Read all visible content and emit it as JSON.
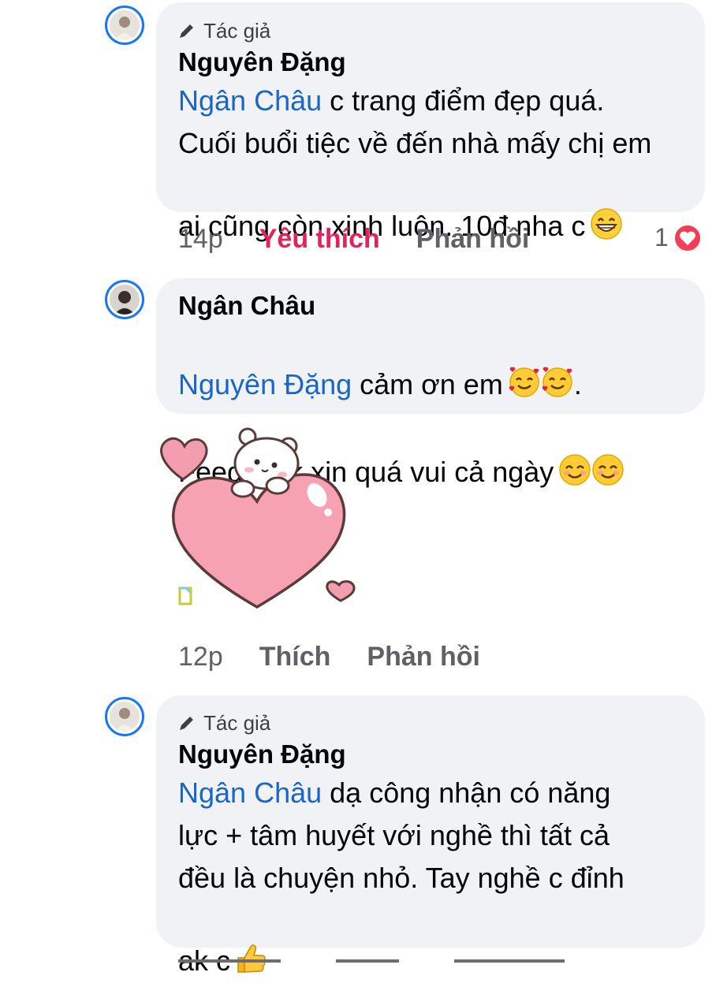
{
  "comments": [
    {
      "badge": "Tác giả",
      "author": "Nguyên Đặng",
      "mention": "Ngân Châu",
      "text_first": " c trang điểm đẹp quá.",
      "text_rest": "Cuối buổi tiệc về đến nhà mấy chị em\nai cũng còn xinh luôn. 10đ nha c",
      "time": "14p",
      "like": "Yêu thích",
      "reply": "Phản hồi",
      "reaction_count": "1",
      "emoji": "grinning-face-icon"
    },
    {
      "author": "Ngân Châu",
      "mention": "Nguyên Đặng",
      "text_first": " cảm ơn em",
      "text_first_end": ".",
      "text_rest": "Feedback xịn quá vui cả ngày",
      "time": "12p",
      "like": "Thích",
      "reply": "Phản hồi",
      "sticker": "bear-heart-sticker"
    },
    {
      "badge": "Tác giả",
      "author": "Nguyên Đặng",
      "mention": "Ngân Châu",
      "text_first": " dạ công nhận có năng",
      "text_rest": "lực + tâm huyết với nghề thì tất cả\nđều là chuyện nhỏ. Tay nghề c đỉnh\nak c",
      "emoji": "thumbs-up-icon"
    }
  ],
  "colors": {
    "mention": "#1a66c7",
    "liked": "#e0245e",
    "avatar_ring": "#1877f2",
    "bubble": "#f0f2f5"
  }
}
